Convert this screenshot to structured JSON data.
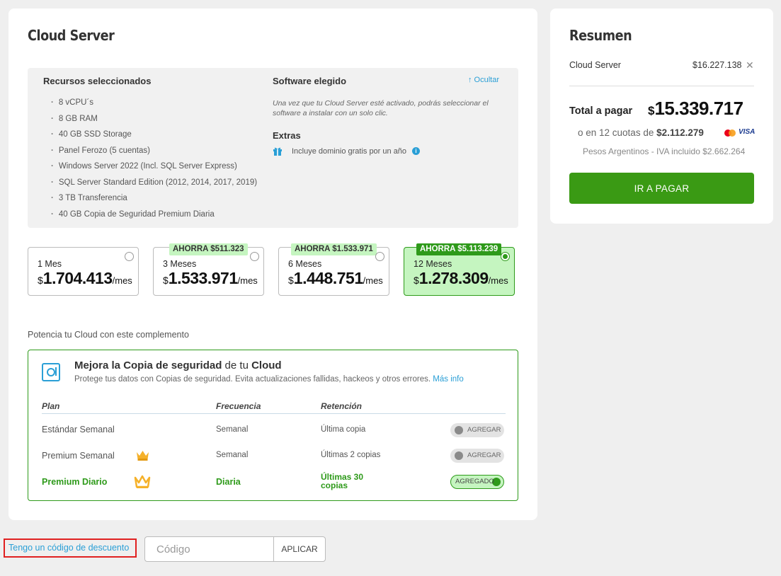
{
  "main": {
    "title": "Cloud Server",
    "resources": {
      "title": "Recursos seleccionados",
      "items": [
        "8 vCPU´s",
        "8 GB RAM",
        "40 GB SSD Storage",
        "Panel Ferozo (5 cuentas)",
        "Windows Server 2022 (Incl. SQL Server Express)",
        "SQL Server Standard Edition (2012, 2014, 2017, 2019)",
        "3 TB Transferencia",
        "40 GB Copia de Seguridad Premium Diaria"
      ]
    },
    "software": {
      "title": "Software elegido",
      "hide_label": "↑ Ocultar",
      "note": "Una vez que tu Cloud Server esté activado, podrás seleccionar el software a instalar con un solo clic.",
      "extras_title": "Extras",
      "extras_item": "Incluye dominio gratis por un año"
    },
    "periods": [
      {
        "label": "1 Mes",
        "currency": "$",
        "amount": "1.704.413",
        "unit": "/mes",
        "badge": "",
        "selected": false
      },
      {
        "label": "3 Meses",
        "currency": "$",
        "amount": "1.533.971",
        "unit": "/mes",
        "badge": "AHORRA $511.323",
        "selected": false
      },
      {
        "label": "6 Meses",
        "currency": "$",
        "amount": "1.448.751",
        "unit": "/mes",
        "badge": "AHORRA $1.533.971",
        "selected": false
      },
      {
        "label": "12 Meses",
        "currency": "$",
        "amount": "1.278.309",
        "unit": "/mes",
        "badge": "AHORRA $5.113.239",
        "selected": true
      }
    ],
    "addon": {
      "caption": "Potencia tu Cloud con este complemento",
      "title_bold_1": "Mejora la Copia de seguridad",
      "title_mid": " de tu ",
      "title_bold_2": "Cloud",
      "subtitle": "Protege tus datos con Copias de seguridad. Evita actualizaciones fallidas, hackeos y otros errores.",
      "more_link": "Más info",
      "headers": {
        "plan": "Plan",
        "frequency": "Frecuencia",
        "retention": "Retención"
      },
      "rows": [
        {
          "plan": "Estándar Semanal",
          "frequency": "Semanal",
          "retention": "Última copia",
          "toggle": "AGREGAR"
        },
        {
          "plan": "Premium Semanal",
          "frequency": "Semanal",
          "retention": "Últimas 2 copias",
          "toggle": "AGREGAR"
        },
        {
          "plan": "Premium Diario",
          "frequency": "Diaria",
          "retention_l1": "Últimas 30",
          "retention_l2": "copias",
          "toggle": "AGREGADO"
        }
      ]
    }
  },
  "discount": {
    "link": "Tengo un código de descuento",
    "placeholder": "Código",
    "apply": "APLICAR"
  },
  "summary": {
    "title": "Resumen",
    "item_name": "Cloud Server",
    "item_price": "$16.227.138",
    "total_label": "Total a pagar",
    "total_currency": "$",
    "total_amount": "15.339.717",
    "cuotas_prefix": "o en 12 cuotas de ",
    "cuotas_amount": "$2.112.279",
    "card_brand": "VISA",
    "taxes": "Pesos Argentinos - IVA incluido $2.662.264",
    "pay_button": "IR A PAGAR"
  },
  "colors": {
    "accent_green": "#2e9a1a",
    "pay_green": "#3a9a14",
    "link_blue": "#2a9fd6",
    "selected_bg": "#c5f5c0"
  }
}
